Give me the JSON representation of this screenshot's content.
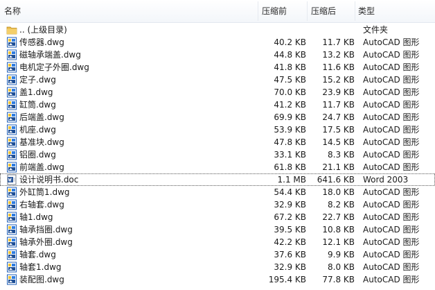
{
  "columns": {
    "name": "名称",
    "before": "压缩前",
    "after": "压缩后",
    "type": "类型"
  },
  "colors": {
    "folder": "#e9b949",
    "file_frame": "#1f5fb8",
    "word": "#2b579a"
  },
  "rows": [
    {
      "name": ".. (上级目录)",
      "before": "",
      "after": "",
      "type": "文件夹",
      "icon": "folder-icon"
    },
    {
      "name": "传感器.dwg",
      "before": "40.2 KB",
      "after": "11.7 KB",
      "type": "AutoCAD 图形",
      "icon": "autocad-file-icon"
    },
    {
      "name": "磁轴承端盖.dwg",
      "before": "44.8 KB",
      "after": "13.2 KB",
      "type": "AutoCAD 图形",
      "icon": "autocad-file-icon"
    },
    {
      "name": "电机定子外圈.dwg",
      "before": "41.8 KB",
      "after": "11.6 KB",
      "type": "AutoCAD 图形",
      "icon": "autocad-file-icon"
    },
    {
      "name": "定子.dwg",
      "before": "47.5 KB",
      "after": "15.2 KB",
      "type": "AutoCAD 图形",
      "icon": "autocad-file-icon"
    },
    {
      "name": "盖1.dwg",
      "before": "70.0 KB",
      "after": "23.9 KB",
      "type": "AutoCAD 图形",
      "icon": "autocad-file-icon"
    },
    {
      "name": "缸筒.dwg",
      "before": "41.2 KB",
      "after": "11.7 KB",
      "type": "AutoCAD 图形",
      "icon": "autocad-file-icon"
    },
    {
      "name": "后端盖.dwg",
      "before": "69.9 KB",
      "after": "24.7 KB",
      "type": "AutoCAD 图形",
      "icon": "autocad-file-icon"
    },
    {
      "name": "机座.dwg",
      "before": "53.9 KB",
      "after": "17.5 KB",
      "type": "AutoCAD 图形",
      "icon": "autocad-file-icon"
    },
    {
      "name": "基准块.dwg",
      "before": "47.8 KB",
      "after": "14.5 KB",
      "type": "AutoCAD 图形",
      "icon": "autocad-file-icon"
    },
    {
      "name": "铝圈.dwg",
      "before": "33.1 KB",
      "after": "8.3 KB",
      "type": "AutoCAD 图形",
      "icon": "autocad-file-icon"
    },
    {
      "name": "前端盖.dwg",
      "before": "61.8 KB",
      "after": "21.1 KB",
      "type": "AutoCAD 图形",
      "icon": "autocad-file-icon"
    },
    {
      "name": "设计说明书.doc",
      "before": "1.1 MB",
      "after": "641.6 KB",
      "type": "Word 2003",
      "icon": "word-doc-icon",
      "focused": true
    },
    {
      "name": "外缸筒1.dwg",
      "before": "54.4 KB",
      "after": "18.0 KB",
      "type": "AutoCAD 图形",
      "icon": "autocad-file-icon"
    },
    {
      "name": "右轴套.dwg",
      "before": "32.9 KB",
      "after": "8.2 KB",
      "type": "AutoCAD 图形",
      "icon": "autocad-file-icon"
    },
    {
      "name": "轴1.dwg",
      "before": "67.2 KB",
      "after": "22.7 KB",
      "type": "AutoCAD 图形",
      "icon": "autocad-file-icon"
    },
    {
      "name": "轴承挡圈.dwg",
      "before": "39.5 KB",
      "after": "10.8 KB",
      "type": "AutoCAD 图形",
      "icon": "autocad-file-icon"
    },
    {
      "name": "轴承外圈.dwg",
      "before": "42.2 KB",
      "after": "12.1 KB",
      "type": "AutoCAD 图形",
      "icon": "autocad-file-icon"
    },
    {
      "name": "轴套.dwg",
      "before": "37.6 KB",
      "after": "9.9 KB",
      "type": "AutoCAD 图形",
      "icon": "autocad-file-icon"
    },
    {
      "name": "轴套1.dwg",
      "before": "32.9 KB",
      "after": "8.0 KB",
      "type": "AutoCAD 图形",
      "icon": "autocad-file-icon"
    },
    {
      "name": "装配图.dwg",
      "before": "195.4 KB",
      "after": "77.8 KB",
      "type": "AutoCAD 图形",
      "icon": "autocad-file-icon"
    }
  ]
}
